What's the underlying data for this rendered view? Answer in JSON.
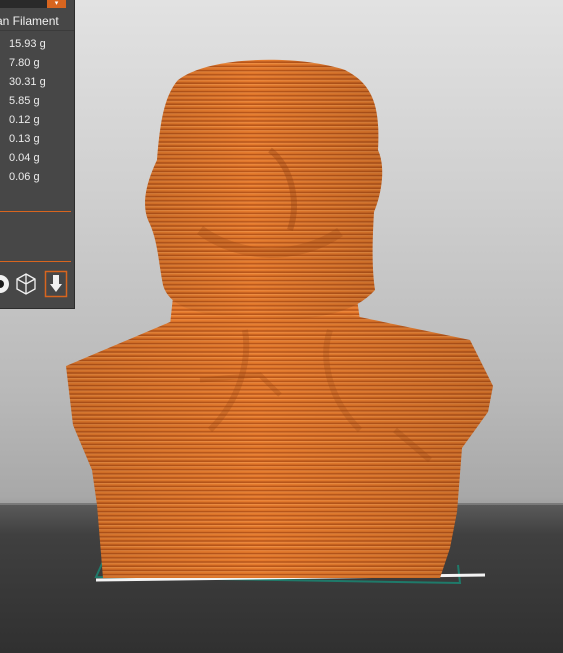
{
  "viewport": {
    "model_color": "#e0762a",
    "bed_outline_color": "#1f7a6a"
  },
  "panel": {
    "accent_color": "#d8651f",
    "dropdown_icon": "chevron-down-icon",
    "filament_label": "an Filament",
    "weights": [
      "15.93 g",
      "7.80 g",
      "30.31 g",
      "5.85 g",
      "0.12 g",
      "0.13 g",
      "0.04 g",
      "0.06 g"
    ],
    "view_icons": [
      "partial-sphere-icon",
      "cube-wireframe-icon",
      "nozzle-icon"
    ]
  }
}
